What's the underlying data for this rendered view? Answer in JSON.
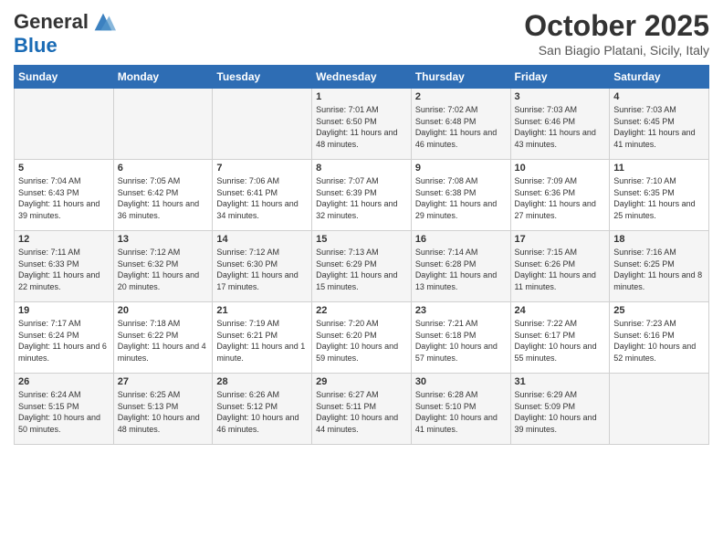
{
  "header": {
    "logo_general": "General",
    "logo_blue": "Blue",
    "month_title": "October 2025",
    "location": "San Biagio Platani, Sicily, Italy"
  },
  "days_of_week": [
    "Sunday",
    "Monday",
    "Tuesday",
    "Wednesday",
    "Thursday",
    "Friday",
    "Saturday"
  ],
  "weeks": [
    [
      {
        "day": "",
        "info": ""
      },
      {
        "day": "",
        "info": ""
      },
      {
        "day": "",
        "info": ""
      },
      {
        "day": "1",
        "info": "Sunrise: 7:01 AM\nSunset: 6:50 PM\nDaylight: 11 hours and 48 minutes."
      },
      {
        "day": "2",
        "info": "Sunrise: 7:02 AM\nSunset: 6:48 PM\nDaylight: 11 hours and 46 minutes."
      },
      {
        "day": "3",
        "info": "Sunrise: 7:03 AM\nSunset: 6:46 PM\nDaylight: 11 hours and 43 minutes."
      },
      {
        "day": "4",
        "info": "Sunrise: 7:03 AM\nSunset: 6:45 PM\nDaylight: 11 hours and 41 minutes."
      }
    ],
    [
      {
        "day": "5",
        "info": "Sunrise: 7:04 AM\nSunset: 6:43 PM\nDaylight: 11 hours and 39 minutes."
      },
      {
        "day": "6",
        "info": "Sunrise: 7:05 AM\nSunset: 6:42 PM\nDaylight: 11 hours and 36 minutes."
      },
      {
        "day": "7",
        "info": "Sunrise: 7:06 AM\nSunset: 6:41 PM\nDaylight: 11 hours and 34 minutes."
      },
      {
        "day": "8",
        "info": "Sunrise: 7:07 AM\nSunset: 6:39 PM\nDaylight: 11 hours and 32 minutes."
      },
      {
        "day": "9",
        "info": "Sunrise: 7:08 AM\nSunset: 6:38 PM\nDaylight: 11 hours and 29 minutes."
      },
      {
        "day": "10",
        "info": "Sunrise: 7:09 AM\nSunset: 6:36 PM\nDaylight: 11 hours and 27 minutes."
      },
      {
        "day": "11",
        "info": "Sunrise: 7:10 AM\nSunset: 6:35 PM\nDaylight: 11 hours and 25 minutes."
      }
    ],
    [
      {
        "day": "12",
        "info": "Sunrise: 7:11 AM\nSunset: 6:33 PM\nDaylight: 11 hours and 22 minutes."
      },
      {
        "day": "13",
        "info": "Sunrise: 7:12 AM\nSunset: 6:32 PM\nDaylight: 11 hours and 20 minutes."
      },
      {
        "day": "14",
        "info": "Sunrise: 7:12 AM\nSunset: 6:30 PM\nDaylight: 11 hours and 17 minutes."
      },
      {
        "day": "15",
        "info": "Sunrise: 7:13 AM\nSunset: 6:29 PM\nDaylight: 11 hours and 15 minutes."
      },
      {
        "day": "16",
        "info": "Sunrise: 7:14 AM\nSunset: 6:28 PM\nDaylight: 11 hours and 13 minutes."
      },
      {
        "day": "17",
        "info": "Sunrise: 7:15 AM\nSunset: 6:26 PM\nDaylight: 11 hours and 11 minutes."
      },
      {
        "day": "18",
        "info": "Sunrise: 7:16 AM\nSunset: 6:25 PM\nDaylight: 11 hours and 8 minutes."
      }
    ],
    [
      {
        "day": "19",
        "info": "Sunrise: 7:17 AM\nSunset: 6:24 PM\nDaylight: 11 hours and 6 minutes."
      },
      {
        "day": "20",
        "info": "Sunrise: 7:18 AM\nSunset: 6:22 PM\nDaylight: 11 hours and 4 minutes."
      },
      {
        "day": "21",
        "info": "Sunrise: 7:19 AM\nSunset: 6:21 PM\nDaylight: 11 hours and 1 minute."
      },
      {
        "day": "22",
        "info": "Sunrise: 7:20 AM\nSunset: 6:20 PM\nDaylight: 10 hours and 59 minutes."
      },
      {
        "day": "23",
        "info": "Sunrise: 7:21 AM\nSunset: 6:18 PM\nDaylight: 10 hours and 57 minutes."
      },
      {
        "day": "24",
        "info": "Sunrise: 7:22 AM\nSunset: 6:17 PM\nDaylight: 10 hours and 55 minutes."
      },
      {
        "day": "25",
        "info": "Sunrise: 7:23 AM\nSunset: 6:16 PM\nDaylight: 10 hours and 52 minutes."
      }
    ],
    [
      {
        "day": "26",
        "info": "Sunrise: 6:24 AM\nSunset: 5:15 PM\nDaylight: 10 hours and 50 minutes."
      },
      {
        "day": "27",
        "info": "Sunrise: 6:25 AM\nSunset: 5:13 PM\nDaylight: 10 hours and 48 minutes."
      },
      {
        "day": "28",
        "info": "Sunrise: 6:26 AM\nSunset: 5:12 PM\nDaylight: 10 hours and 46 minutes."
      },
      {
        "day": "29",
        "info": "Sunrise: 6:27 AM\nSunset: 5:11 PM\nDaylight: 10 hours and 44 minutes."
      },
      {
        "day": "30",
        "info": "Sunrise: 6:28 AM\nSunset: 5:10 PM\nDaylight: 10 hours and 41 minutes."
      },
      {
        "day": "31",
        "info": "Sunrise: 6:29 AM\nSunset: 5:09 PM\nDaylight: 10 hours and 39 minutes."
      },
      {
        "day": "",
        "info": ""
      }
    ]
  ]
}
